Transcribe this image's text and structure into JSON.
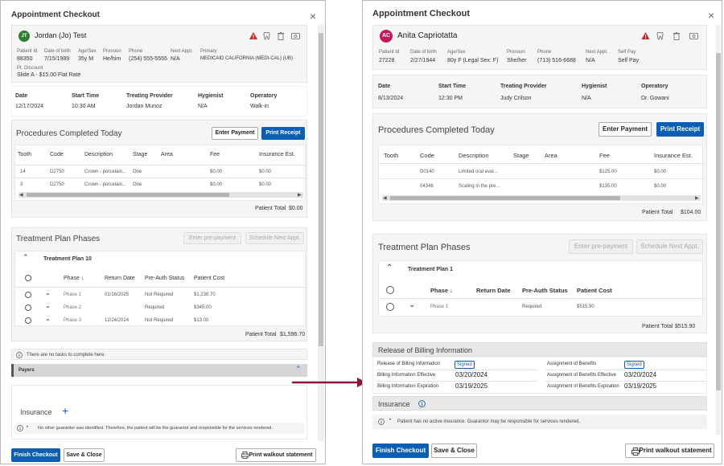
{
  "left": {
    "title": "Appointment Checkout",
    "close_glyph": "×",
    "avatar": "JT",
    "patient_name": "Jordan (Jo) Test",
    "patient_fields": [
      {
        "label": "Patient Id",
        "value": "88350"
      },
      {
        "label": "Date of birth",
        "value": "7/15/1989"
      },
      {
        "label": "Age/Sex",
        "value": "35y M"
      },
      {
        "label": "Pronoun",
        "value": "He/him"
      },
      {
        "label": "Phone",
        "value": "(254) 555-5555"
      },
      {
        "label": "Next Appt.",
        "value": "N/A"
      },
      {
        "label": "Primary",
        "value": "MEDICAID CALIFORNIA (MEDI-CAL) (UB)"
      }
    ],
    "discount_label": "Pt. Discount",
    "discount_value": "Slide A - $15.00 Flat Rate",
    "appt_fields": [
      {
        "label": "Date",
        "value": "12/17/2024"
      },
      {
        "label": "Start Time",
        "value": "10:30 AM"
      },
      {
        "label": "Treating Provider",
        "value": "Jordan Munoz"
      },
      {
        "label": "Hygienist",
        "value": "N/A"
      },
      {
        "label": "Operatory",
        "value": "Walk-in"
      }
    ],
    "procedures_title": "Procedures Completed Today",
    "enter_payment": "Enter Payment",
    "print_receipt": "Print Receipt",
    "proc_headers": [
      "Tooth",
      "Code",
      "Description",
      "Stage",
      "Area",
      "Fee",
      "Insurance Est."
    ],
    "proc_rows": [
      [
        "14",
        "D2750",
        "Crown - porcelain...",
        "One",
        "",
        "$0.00",
        "$0.00"
      ],
      [
        "3",
        "D2750",
        "Crown - porcelain...",
        "One",
        "",
        "$0.00",
        "$0.00"
      ]
    ],
    "patient_total_label": "Patient Total",
    "patient_total": "$0.00",
    "treatment_title": "Treatment Plan Phases",
    "enter_prepayment": "Enter pre-payment",
    "schedule_next": "Schedule Next Appt.",
    "plan_name": "Treatment Plan 10",
    "plan_headers": [
      "Phase ↓",
      "Return Date",
      "Pre-Auth Status",
      "Patient Cost"
    ],
    "plan_rows": [
      [
        "Phase 1",
        "01/16/2025",
        "Not Required",
        "$1,238.70"
      ],
      [
        "Phase 2",
        "",
        "Required",
        "$345.00"
      ],
      [
        "Phase 3",
        "12/24/2024",
        "Not Required",
        "$13.00"
      ]
    ],
    "plan_total_label": "Patient Total",
    "plan_total": "$1,596.70",
    "no_tasks": "There are no tasks to complete here.",
    "payers": "Payers",
    "insurance": "Insurance",
    "guarantor_note": "No other guarantor was identified. Therefore, the patient will be the guarantor and responsible for the services rendered.",
    "finish": "Finish Checkout",
    "save_close": "Save & Close",
    "print_walkout": "Print walkout statement"
  },
  "right": {
    "title": "Appointment Checkout",
    "close_glyph": "×",
    "avatar": "AC",
    "patient_name": "Anita Capriotatta",
    "patient_fields": [
      {
        "label": "Patient Id",
        "value": "27228"
      },
      {
        "label": "Date of birth",
        "value": "2/27/1944"
      },
      {
        "label": "Age/Sex",
        "value": "80y F (Legal Sex: F)"
      },
      {
        "label": "Pronoun",
        "value": "She/her"
      },
      {
        "label": "Phone",
        "value": "(713) 516-6688"
      },
      {
        "label": "Next Appt.",
        "value": "N/A"
      },
      {
        "label": "Self Pay",
        "value": "Self Pay"
      }
    ],
    "appt_fields": [
      {
        "label": "Date",
        "value": "8/13/2024"
      },
      {
        "label": "Start Time",
        "value": "12:30 PM"
      },
      {
        "label": "Treating Provider",
        "value": "Judy Crilson"
      },
      {
        "label": "Hygienist",
        "value": "N/A"
      },
      {
        "label": "Operatory",
        "value": "Dr. Gowani"
      }
    ],
    "procedures_title": "Procedures Completed Today",
    "enter_payment": "Enter Payment",
    "print_receipt": "Print Receipt",
    "proc_headers": [
      "Tooth",
      "Code",
      "Description",
      "Stage",
      "Area",
      "Fee",
      "Insurance Est."
    ],
    "proc_rows": [
      [
        "",
        "D0140",
        "Limited oral eval...",
        "",
        "",
        "$125.00",
        "$0.00"
      ],
      [
        "",
        "04346",
        "Scaling in the pre...",
        "",
        "",
        "$135.00",
        "$0.00"
      ]
    ],
    "patient_total_label": "Patient Total",
    "patient_total": "$104.00",
    "treatment_title": "Treatment Plan Phases",
    "enter_prepayment": "Enter pre-payment",
    "schedule_next": "Schedule Next Appt.",
    "plan_name": "Treatment Plan 1",
    "plan_headers": [
      "Phase ↓",
      "Return Date",
      "Pre-Auth Status",
      "Patient Cost"
    ],
    "plan_rows": [
      [
        "Phase 1",
        "",
        "Required",
        "$515.90"
      ]
    ],
    "plan_total_label": "Patient Total",
    "plan_total": "$515.90",
    "billing_title": "Release of Billing Information",
    "billing_release_label": "Release of Billing Information",
    "billing_assignment_label": "Assignment of Benefits",
    "signed": "Signed",
    "billing_eff_label": "Billing Information Effective",
    "billing_eff": "03/20/2024",
    "assign_eff_label": "Assignment of Benefits Effective",
    "assign_eff": "03/20/2024",
    "billing_exp_label": "Billing Information Expiration",
    "billing_exp": "03/19/2025",
    "assign_exp_label": "Assignment of Benefits Expiration",
    "assign_exp": "03/19/2025",
    "insurance": "Insurance",
    "insurance_note": "Patient has no active insurance. Guarantor may be responsible for services rendered.",
    "finish": "Finish Checkout",
    "save_close": "Save & Close",
    "print_walkout": "Print walkout statement"
  },
  "colors": {
    "primary": "#0a5fb5",
    "alert": "#c62828",
    "avatar_left": "#2e7d32",
    "avatar_right": "#c2185b",
    "arrow": "#8b1538"
  }
}
